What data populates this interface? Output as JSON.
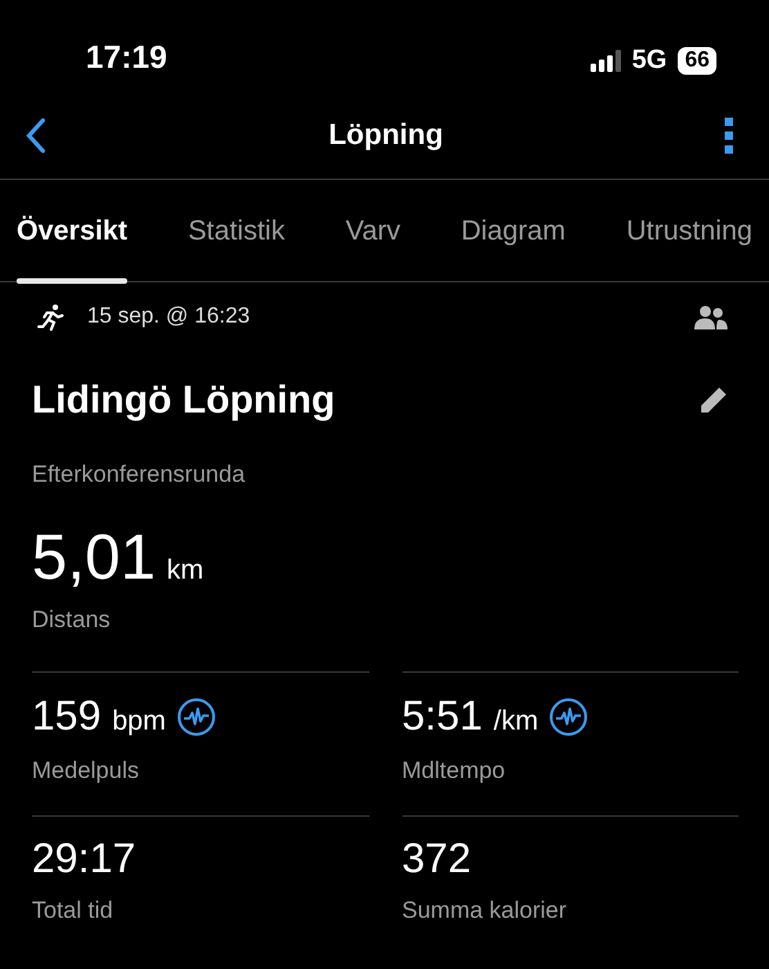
{
  "status_bar": {
    "time": "17:19",
    "network": "5G",
    "battery": "66"
  },
  "nav_bar": {
    "title": "Löpning"
  },
  "tabs": [
    {
      "label": "Översikt",
      "selected": true
    },
    {
      "label": "Statistik",
      "selected": false
    },
    {
      "label": "Varv",
      "selected": false
    },
    {
      "label": "Diagram",
      "selected": false
    },
    {
      "label": "Utrustning",
      "selected": false
    }
  ],
  "activity": {
    "date": "15 sep. @ 16:23",
    "name": "Lidingö Löpning",
    "description": "Efterkonferensrunda",
    "distance": {
      "value": "5,01",
      "unit": "km",
      "label": "Distans"
    }
  },
  "stats": [
    {
      "value": "159",
      "unit": "bpm",
      "label": "Medelpuls",
      "graph_icon": true
    },
    {
      "value": "5:51",
      "unit": "/km",
      "label": "Mdltempo",
      "graph_icon": true
    },
    {
      "value": "29:17",
      "label": "Total tid",
      "graph_icon": false
    },
    {
      "value": "372",
      "label": "Summa kalorier",
      "graph_icon": false
    }
  ]
}
